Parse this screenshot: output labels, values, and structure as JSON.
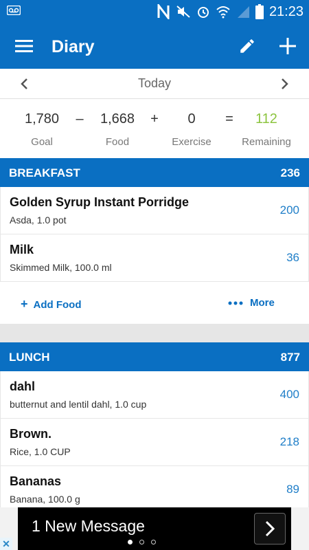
{
  "status_bar": {
    "time": "21:23"
  },
  "app_bar": {
    "title": "Diary"
  },
  "date_nav": {
    "date": "Today"
  },
  "summary": {
    "goal_value": "1,780",
    "minus": "–",
    "food_value": "1,668",
    "plus": "+",
    "exercise_value": "0",
    "equals": "=",
    "remaining_value": "112",
    "goal_label": "Goal",
    "food_label": "Food",
    "exercise_label": "Exercise",
    "remaining_label": "Remaining"
  },
  "breakfast": {
    "name": "BREAKFAST",
    "total": "236",
    "items": [
      {
        "name": "Golden Syrup Instant Porridge",
        "desc": "Asda, 1.0 pot",
        "cal": "200"
      },
      {
        "name": "Milk",
        "desc": "Skimmed Milk, 100.0 ml",
        "cal": "36"
      }
    ],
    "add_food": "Add Food",
    "more": "More"
  },
  "lunch": {
    "name": "LUNCH",
    "total": "877",
    "items": [
      {
        "name": "dahl",
        "desc": "butternut and lentil dahl, 1.0 cup",
        "cal": "400"
      },
      {
        "name": "Brown.",
        "desc": "Rice, 1.0 CUP",
        "cal": "218"
      },
      {
        "name": "Bananas",
        "desc": "Banana, 100.0 g",
        "cal": "89"
      }
    ]
  },
  "ad": {
    "message": "1 New Message"
  },
  "colors": {
    "primary": "#0a6fc2",
    "remaining": "#8cc43f",
    "calorie": "#1f7ec8"
  }
}
